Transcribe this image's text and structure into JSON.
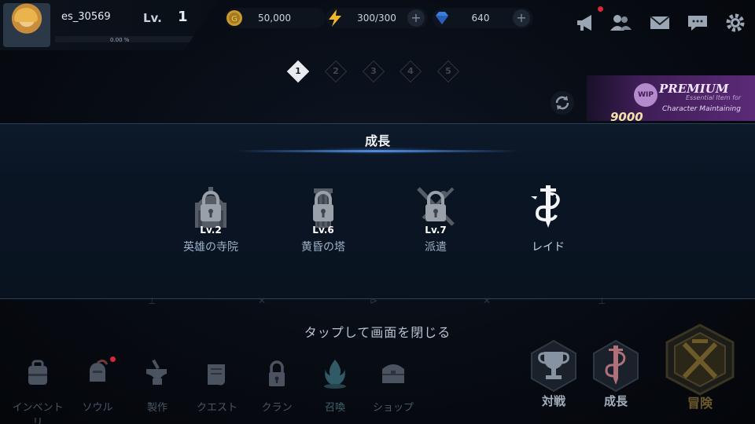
{
  "player": {
    "name": "es_30569",
    "level_label": "Lv.",
    "level": "1",
    "exp_percent": "0.00 %"
  },
  "currencies": {
    "gold": "50,000",
    "stamina": "300/300",
    "gems": "640"
  },
  "stages": [
    "1",
    "2",
    "3",
    "4",
    "5"
  ],
  "active_stage": "1",
  "banner": {
    "badge": "WIP",
    "title": "PREMIUM",
    "subtitle": "Essential Item for",
    "subtitle2": "Character Maintaining",
    "price": "9000"
  },
  "modal": {
    "title": "成長",
    "items": [
      {
        "label": "英雄の寺院",
        "level": "Lv.2",
        "locked": true,
        "icon": "temple-icon"
      },
      {
        "label": "黄昏の塔",
        "level": "Lv.6",
        "locked": true,
        "icon": "tower-icon"
      },
      {
        "label": "派遣",
        "level": "Lv.7",
        "locked": true,
        "icon": "dispatch-icon"
      },
      {
        "label": "レイド",
        "level": "",
        "locked": false,
        "icon": "dragon-sword-icon"
      }
    ]
  },
  "close_hint": "タップして画面を閉じる",
  "nav": {
    "items": [
      {
        "label": "インベントリ",
        "icon": "inventory-icon"
      },
      {
        "label": "ソウル",
        "icon": "soul-knight-icon"
      },
      {
        "label": "製作",
        "icon": "anvil-icon"
      },
      {
        "label": "クエスト",
        "icon": "quest-scroll-icon"
      },
      {
        "label": "クラン",
        "icon": "lock-icon"
      },
      {
        "label": "召喚",
        "icon": "summon-flame-icon"
      },
      {
        "label": "ショップ",
        "icon": "shop-chest-icon"
      }
    ],
    "battle": "対戦",
    "growth": "成長",
    "adventure": "冒険"
  },
  "colors": {
    "accent_blue": "#4e8ce0",
    "notification_red": "#d6273b",
    "stamina_yellow": "#f0b52a",
    "gem_blue": "#3a7de0",
    "gold": "#c99a2e"
  }
}
